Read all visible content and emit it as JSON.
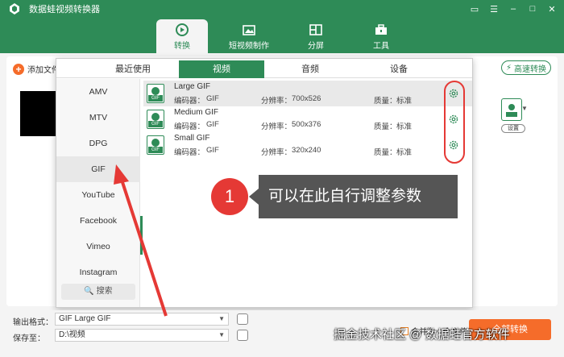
{
  "window": {
    "title": "数据蛙视频转换器"
  },
  "main_tabs": [
    {
      "label": "转换",
      "icon": "convert-icon"
    },
    {
      "label": "短视频制作",
      "icon": "short-video-icon"
    },
    {
      "label": "分屏",
      "icon": "split-screen-icon"
    },
    {
      "label": "工具",
      "icon": "toolbox-icon"
    }
  ],
  "toolbar": {
    "add_file": "添加文件",
    "high_speed": "高速转换",
    "settings": "设置"
  },
  "format_panel": {
    "tabs": [
      "最近使用",
      "视频",
      "音频",
      "设备"
    ],
    "active_tab": 1,
    "sidebar": [
      "AMV",
      "MTV",
      "DPG",
      "GIF",
      "YouTube",
      "Facebook",
      "Vimeo",
      "Instagram"
    ],
    "active_sidebar": 3,
    "search": "搜索",
    "presets": [
      {
        "name": "Large GIF",
        "encoder_label": "编码器：",
        "encoder": "GIF",
        "res_label": "分辨率：",
        "resolution": "700x526",
        "quality_label": "质量：",
        "quality": "标准"
      },
      {
        "name": "Medium GIF",
        "encoder_label": "编码器：",
        "encoder": "GIF",
        "res_label": "分辨率：",
        "resolution": "500x376",
        "quality_label": "质量：",
        "quality": "标准"
      },
      {
        "name": "Small GIF",
        "encoder_label": "编码器：",
        "encoder": "GIF",
        "res_label": "分辨率：",
        "resolution": "320x240",
        "quality_label": "质量：",
        "quality": "标准"
      }
    ]
  },
  "callout": {
    "number": "1",
    "text": "可以在此自行调整参数"
  },
  "bottom": {
    "output_label": "输出格式：",
    "output_value": "GIF Large GIF",
    "save_label": "保存至：",
    "save_value": "D:\\视频",
    "merge": "合并为一个文件",
    "convert_all": "全部转换"
  },
  "watermark": "掘金技术社区 @ 数据蛙官方软件",
  "colors": {
    "brand": "#2e8b57",
    "accent": "#f56c2a",
    "annotation": "#e53935"
  }
}
